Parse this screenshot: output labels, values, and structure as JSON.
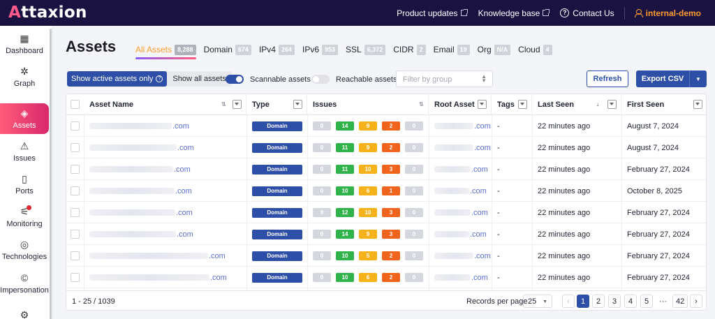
{
  "app": {
    "logo": "Attaxion"
  },
  "topnav": {
    "product_updates": "Product updates",
    "knowledge_base": "Knowledge base",
    "contact_us": "Contact Us",
    "user": "internal-demo"
  },
  "sidebar": {
    "items": [
      {
        "label": "Dashboard",
        "icon": "dashboard-icon",
        "glyph": "▦"
      },
      {
        "label": "Graph",
        "icon": "graph-icon",
        "glyph": "✲"
      },
      {
        "label": "Assets",
        "icon": "assets-icon",
        "glyph": "◈",
        "active": true
      },
      {
        "label": "Issues",
        "icon": "warning-icon",
        "glyph": "⚠"
      },
      {
        "label": "Ports",
        "icon": "ports-icon",
        "glyph": "▯"
      },
      {
        "label": "Monitoring",
        "icon": "monitoring-icon",
        "glyph": "⚟",
        "badge": true
      },
      {
        "label": "Technologies",
        "icon": "fingerprint-icon",
        "glyph": "◎"
      },
      {
        "label": "Impersonation",
        "icon": "copyright-icon",
        "glyph": "©"
      },
      {
        "label": "",
        "icon": "settings-icon",
        "glyph": "⚙"
      }
    ]
  },
  "page": {
    "title": "Assets"
  },
  "tabs": [
    {
      "label": "All Assets",
      "count": "8,288",
      "active": true
    },
    {
      "label": "Domain",
      "count": "674"
    },
    {
      "label": "IPv4",
      "count": "264"
    },
    {
      "label": "IPv6",
      "count": "953"
    },
    {
      "label": "SSL",
      "count": "6,372"
    },
    {
      "label": "CIDR",
      "count": "2"
    },
    {
      "label": "Email",
      "count": "19"
    },
    {
      "label": "Org",
      "count": "N/A"
    },
    {
      "label": "Cloud",
      "count": "4"
    }
  ],
  "toolbar": {
    "active_only": "Show active assets only",
    "show_all": "Show all assets",
    "scannable": "Scannable assets",
    "scannable_on": true,
    "reachable": "Reachable assets",
    "reachable_on": false,
    "group_placeholder": "Filter by group",
    "refresh": "Refresh",
    "export": "Export CSV"
  },
  "table": {
    "columns": [
      "Asset Name",
      "Type",
      "Issues",
      "Root Asset",
      "Tags",
      "Last Seen",
      "First Seen"
    ],
    "rows": [
      {
        "asset_suffix": ".com",
        "type": "Domain",
        "issues": [
          "0",
          "14",
          "9",
          "2",
          "0"
        ],
        "root_suffix": ".com",
        "tags": "-",
        "last_seen": "22 minutes ago",
        "first_seen": "August 7, 2024"
      },
      {
        "asset_suffix": ".com",
        "type": "Domain",
        "issues": [
          "0",
          "11",
          "9",
          "2",
          "0"
        ],
        "root_suffix": ".com",
        "tags": "-",
        "last_seen": "22 minutes ago",
        "first_seen": "August 7, 2024"
      },
      {
        "asset_suffix": ".com",
        "type": "Domain",
        "issues": [
          "0",
          "11",
          "10",
          "3",
          "0"
        ],
        "root_suffix": ".com",
        "tags": "-",
        "last_seen": "22 minutes ago",
        "first_seen": "February 27, 2024"
      },
      {
        "asset_suffix": ".com",
        "type": "Domain",
        "issues": [
          "0",
          "10",
          "6",
          "1",
          "0"
        ],
        "root_suffix": ".com",
        "tags": "-",
        "last_seen": "22 minutes ago",
        "first_seen": "October 8, 2025"
      },
      {
        "asset_suffix": ".com",
        "type": "Domain",
        "issues": [
          "0",
          "12",
          "10",
          "3",
          "0"
        ],
        "root_suffix": ".com",
        "tags": "-",
        "last_seen": "22 minutes ago",
        "first_seen": "February 27, 2024"
      },
      {
        "asset_suffix": ".com",
        "type": "Domain",
        "issues": [
          "0",
          "14",
          "9",
          "3",
          "0"
        ],
        "root_suffix": ".com",
        "tags": "-",
        "last_seen": "22 minutes ago",
        "first_seen": "February 27, 2024"
      },
      {
        "asset_suffix": ".com",
        "type": "Domain",
        "issues": [
          "0",
          "10",
          "5",
          "2",
          "0"
        ],
        "root_suffix": ".com",
        "tags": "-",
        "last_seen": "22 minutes ago",
        "first_seen": "February 27, 2024"
      },
      {
        "asset_suffix": ".com",
        "type": "Domain",
        "issues": [
          "0",
          "10",
          "6",
          "2",
          "0"
        ],
        "root_suffix": ".com",
        "tags": "-",
        "last_seen": "22 minutes ago",
        "first_seen": "February 27, 2024"
      }
    ]
  },
  "footer": {
    "range": "1 - 25 / 1039",
    "records_per_page_label": "Records per page",
    "records_per_page": "25",
    "pages": [
      "1",
      "2",
      "3",
      "4",
      "5",
      "···",
      "42"
    ],
    "current_page": "1",
    "prev": "‹",
    "next": "›"
  }
}
